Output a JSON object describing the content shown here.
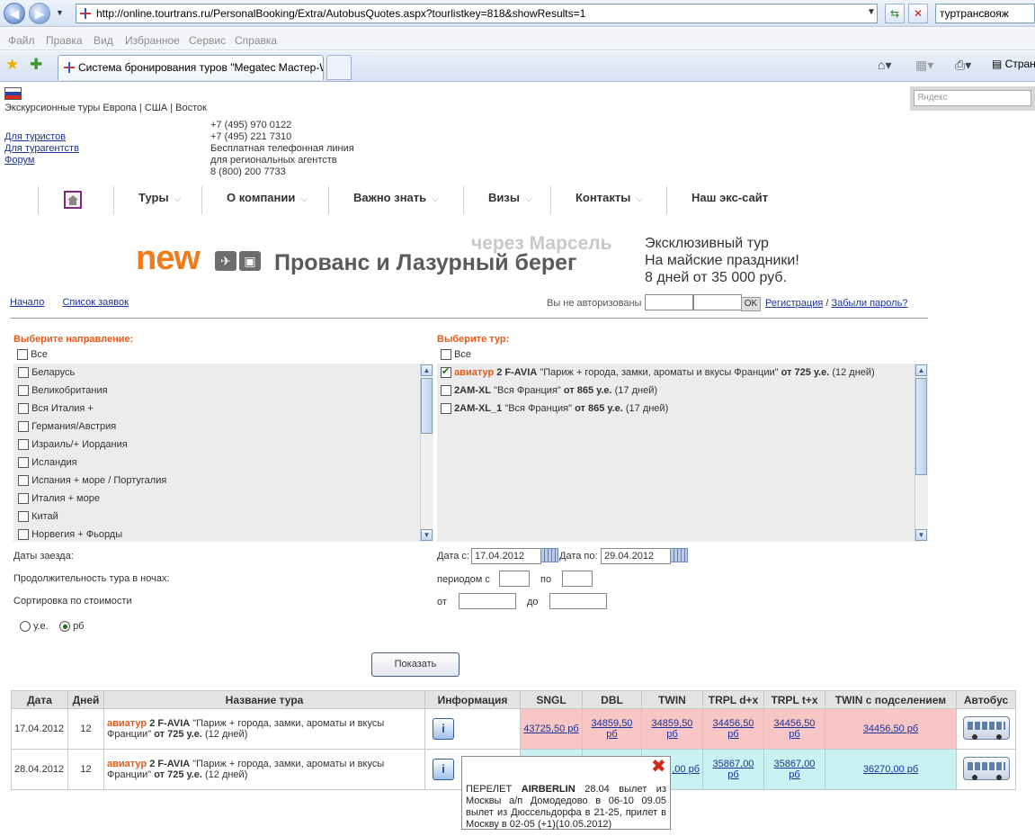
{
  "browser": {
    "url": "http://online.tourtrans.ru/PersonalBooking/Extra/AutobusQuotes.aspx?tourlistkey=818&showResults=1",
    "search_text": "туртрансвояж",
    "menu": [
      "Файл",
      "Правка",
      "Вид",
      "Избранное",
      "Сервис",
      "Справка"
    ],
    "tab_title": "Система бронирования туров \"Megatec Мастер-Web\"",
    "page_button": "Стран"
  },
  "yandex_placeholder": "Яндекс",
  "header": {
    "topline": "Экскурсионные туры Европа | США | Восток",
    "links": [
      "Для туристов",
      "Для турагентств",
      "Форум"
    ],
    "phones": [
      "+7 (495) 970 0122",
      "+7 (495) 221 7310",
      "Бесплатная телефонная линия",
      "для региональных агентств",
      "8 (800) 200 7733"
    ]
  },
  "nav": {
    "items": [
      "Туры",
      "О компании",
      "Важно знать",
      "Визы",
      "Контакты",
      "Наш экс-сайт"
    ]
  },
  "banner": {
    "new": "new",
    "via": "через Марсель",
    "title": "Прованс и Лазурный берег",
    "right": [
      "Эксклюзивный тур",
      "На майские праздники!",
      "8 дней от 35 000 руб."
    ]
  },
  "crumbs": [
    "Начало",
    "Список заявок"
  ],
  "auth": {
    "text": "Вы не авторизованы",
    "ok": "OK",
    "register": "Регистрация",
    "sep": "/",
    "forgot": "Забыли пароль?"
  },
  "direction": {
    "title": "Выберите направление:",
    "all": "Все",
    "items": [
      "Беларусь",
      "Великобритания",
      "Вся Италия +",
      "Германия/Австрия",
      "Израиль/+ Иордания",
      "Исландия",
      "Испания + море / Португалия",
      "Италия + море",
      "Китай",
      "Норвегия + Фьорды"
    ]
  },
  "tour": {
    "title": "Выберите тур:",
    "all": "Все",
    "items": [
      {
        "prefix": "авиатур",
        "code": "2 F-AVIA",
        "name": "\"Париж + города, замки, ароматы и вкусы Франции\"",
        "price": "от 725 у.е.",
        "days": "(12 дней)",
        "checked": true
      },
      {
        "prefix": "",
        "code": "2AM-XL",
        "name": "\"Вся Франция\"",
        "price": "от 865 у.е.",
        "days": "(17 дней)",
        "checked": false
      },
      {
        "prefix": "",
        "code": "2AM-XL_1",
        "name": "\"Вся Франция\"",
        "price": "от 865 у.е.",
        "days": "(17 дней)",
        "checked": false
      }
    ]
  },
  "filters": {
    "dates_label": "Даты заезда:",
    "date_from_label": "Дата с:",
    "date_from": "17.04.2012",
    "date_to_label": "Дата по:",
    "date_to": "29.04.2012",
    "nights_label": "Продолжительность тура в ночах:",
    "period_from": "периодом с",
    "period_to": "по",
    "sort_label": "Сортировка по стоимости",
    "price_from": "от",
    "price_to": "до",
    "currency_ue": "у.е.",
    "currency_rub": "рб",
    "currency_selected": "рб"
  },
  "show_button": "Показать",
  "results": {
    "columns": [
      "Дата",
      "Дней",
      "Название тура",
      "Информация",
      "SNGL",
      "DBL",
      "TWIN",
      "TRPL d+x",
      "TRPL t+x",
      "TWIN с подселением",
      "Автобус"
    ],
    "rows": [
      {
        "date": "17.04.2012",
        "days": "12",
        "prefix": "авиатур",
        "code": "2 F-AVIA",
        "name": "\"Париж + города, замки, ароматы и вкусы Франции\"",
        "price": "от 725 у.е.",
        "tdays": "(12 дней)",
        "prices": [
          "43725,50 рб",
          "34859,50 рб",
          "34859,50 рб",
          "34456,50 рб",
          "34456,50 рб",
          "34456,50 рб"
        ],
        "color": "#f9c6c6"
      },
      {
        "date": "28.04.2012",
        "days": "12",
        "prefix": "авиатур",
        "code": "2 F-AVIA",
        "name": "\"Париж + города, замки, ароматы и вкусы Франции\"",
        "price": "от 725 у.е.",
        "tdays": "(12 дней)",
        "prices": [
          "",
          "",
          ",00 рб",
          "35867,00 рб",
          "35867,00 рб",
          "36270,00 рб"
        ],
        "color": "#c9f2f2"
      }
    ]
  },
  "tooltip": {
    "line1_a": "ПЕРЕЛЕТ",
    "line1_b": "AIRBERLIN",
    "line1_c": "28.04 вылет из Москвы а/п Домодедово в 06-10 09.05 вылет из Дюссельдорфа в 21-25, прилет в Москву в 02-05 (+1)(10.05.2012)"
  },
  "colors": {
    "accent_orange": "#e8591a",
    "link_blue": "#1a3399",
    "row_pink": "#f9c6c6",
    "row_cyan": "#c9f2f2"
  }
}
